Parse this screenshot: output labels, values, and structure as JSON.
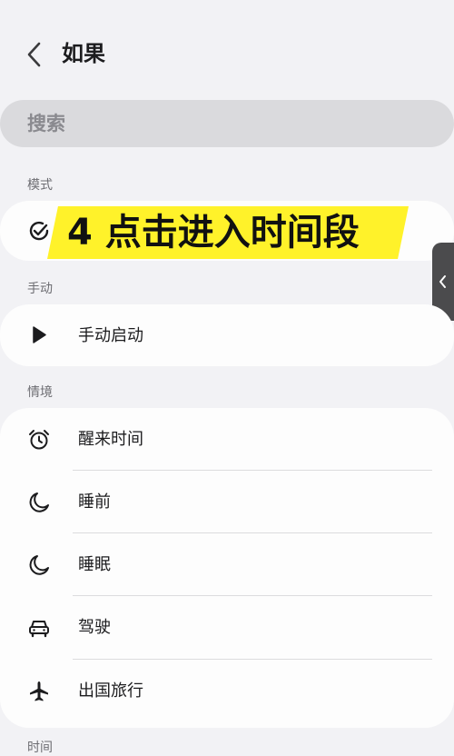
{
  "header": {
    "title": "如果"
  },
  "search": {
    "placeholder": "搜索"
  },
  "sections": {
    "mode": {
      "label": "模式"
    },
    "manual": {
      "label": "手动",
      "item": "手动启动"
    },
    "scenes": {
      "label": "情境",
      "items": [
        {
          "label": "醒来时间",
          "icon": "alarm-clock-icon"
        },
        {
          "label": "睡前",
          "icon": "moon-icon"
        },
        {
          "label": "睡眠",
          "icon": "moon-icon"
        },
        {
          "label": "驾驶",
          "icon": "car-icon"
        },
        {
          "label": "出国旅行",
          "icon": "airplane-icon"
        }
      ]
    },
    "time": {
      "label": "时间"
    }
  },
  "overlay": {
    "text": "4 点击进入时间段"
  },
  "colors": {
    "background": "#f2f2f5",
    "card": "#fdfdfd",
    "banner": "#fff22a"
  }
}
